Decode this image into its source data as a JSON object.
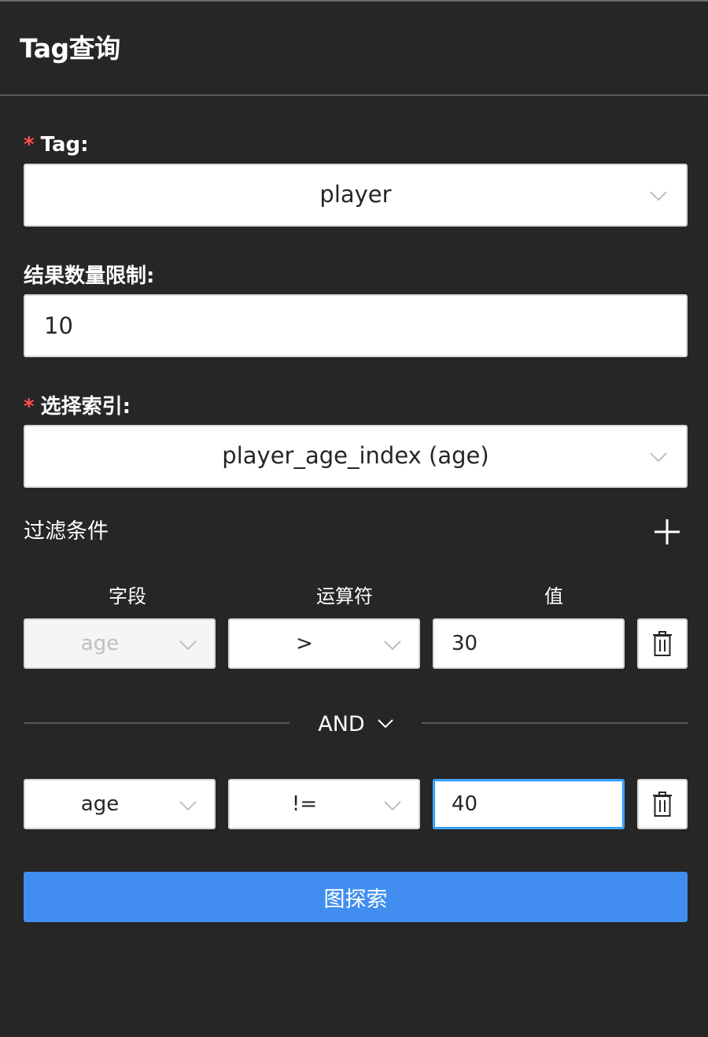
{
  "panel": {
    "title": "Tag查询"
  },
  "form": {
    "tag": {
      "label": "Tag",
      "colon": ":",
      "required_mark": "*",
      "value": "player"
    },
    "limit": {
      "label": "结果数量限制",
      "colon": ":",
      "value": "10"
    },
    "index": {
      "label": "选择索引",
      "colon": ":",
      "required_mark": "*",
      "value": "player_age_index (age)"
    }
  },
  "filters": {
    "title": "过滤条件",
    "add_icon": "plus-icon",
    "columns": [
      "字段",
      "运算符",
      "值"
    ],
    "rows": [
      {
        "field": "age",
        "operator": ">",
        "value": "30",
        "field_disabled": true
      },
      {
        "field": "age",
        "operator": "!=",
        "value": "40",
        "value_focused": true
      }
    ],
    "logic": {
      "value": "AND",
      "icon": "chevron-down-icon"
    },
    "delete_icon": "trash-icon"
  },
  "submit": {
    "label": "图探索"
  },
  "colors": {
    "background": "#262626",
    "primary": "#418ef0",
    "required": "#ff4d4f",
    "focus": "#40a9ff",
    "disabled_bg": "#f5f5f5"
  }
}
